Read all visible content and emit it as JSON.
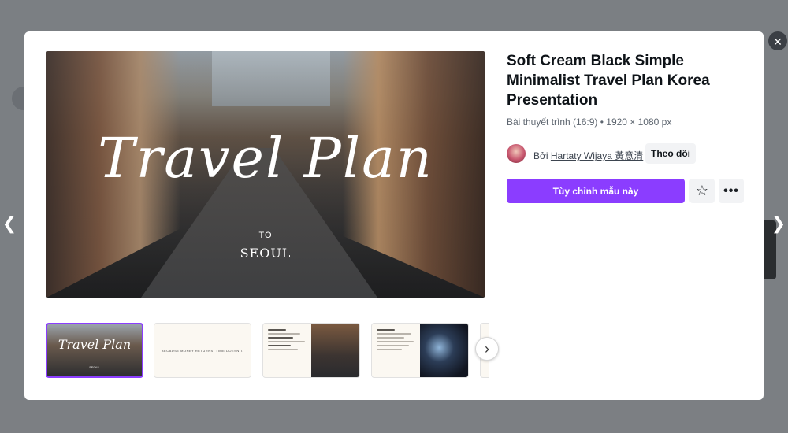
{
  "template": {
    "title": "Soft Cream Black Simple Minimalist Travel Plan Korea Presentation",
    "meta": "Bài thuyết trình (16:9) • 1920 × 1080 px",
    "author_prefix": "Bởi",
    "author_name": "Hartaty Wijaya 黃意清",
    "follow_label": "Theo dõi",
    "customize_label": "Tùy chỉnh mẫu này"
  },
  "preview": {
    "title": "Travel Plan",
    "to": "TO",
    "city": "SEOUL"
  },
  "thumbnails": {
    "t1_title": "Travel Plan",
    "t1_city": "SEOUL",
    "t2_quote": "BECAUSE MONEY RETURNS, TIME DOESN'T."
  },
  "icons": {
    "close": "close-icon",
    "prev": "chevron-left-icon",
    "next": "chevron-right-icon",
    "star": "star-icon",
    "more": "more-horizontal-icon",
    "thumbs_next": "chevron-right-icon"
  },
  "colors": {
    "accent": "#8b3dff"
  }
}
